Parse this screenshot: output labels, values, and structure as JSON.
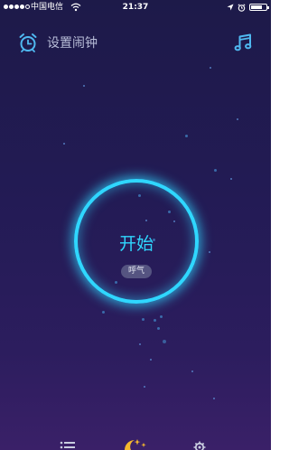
{
  "status_bar": {
    "carrier": "中国电信",
    "time": "21:37",
    "battery_level": 0.75
  },
  "header": {
    "alarm_label": "设置闹钟"
  },
  "main": {
    "start_label": "开始",
    "breath_label": "呼气"
  },
  "icons": {
    "alarm": "alarm-clock-icon",
    "music": "music-note-icon",
    "list": "list-icon",
    "sleep": "moon-stars-icon",
    "settings": "gear-icon"
  },
  "colors": {
    "accent": "#2fd7ff",
    "icon": "#4fb8f0",
    "background_top": "#1d1a49",
    "background_bottom": "#3a2068",
    "sleep_tab": "#f5b82e"
  }
}
